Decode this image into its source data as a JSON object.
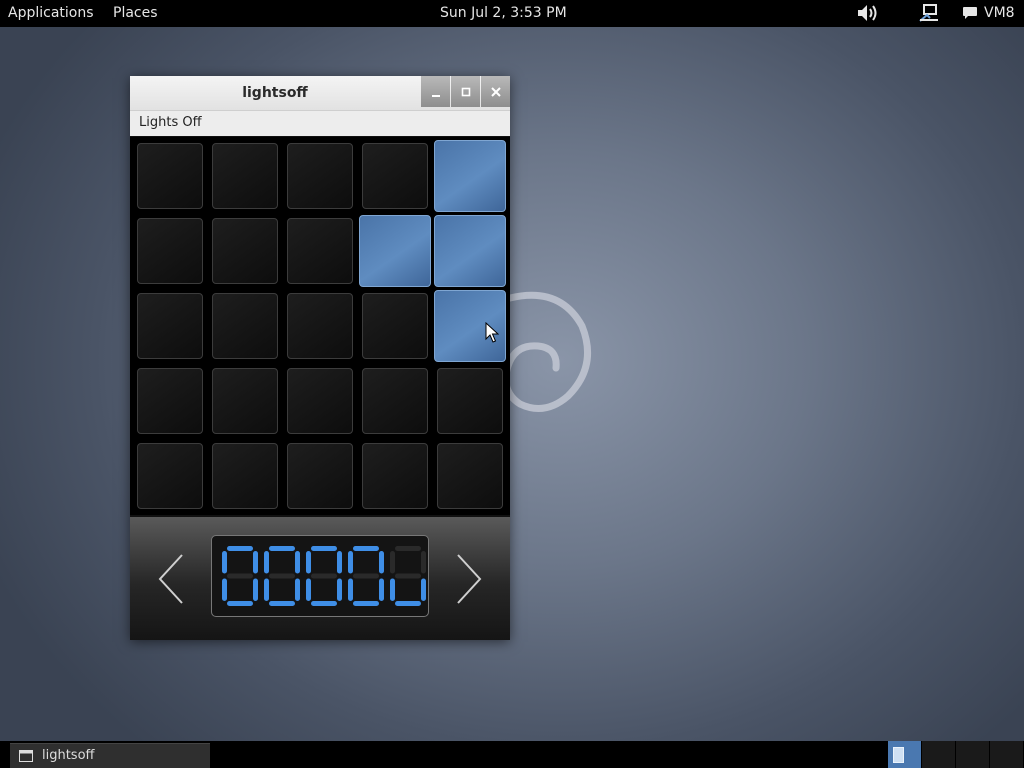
{
  "top_panel": {
    "applications": "Applications",
    "places": "Places",
    "clock": "Sun Jul  2,  3:53 PM",
    "user": "VM8"
  },
  "window": {
    "title": "lightsoff",
    "menu": [
      "Lights Off"
    ],
    "board": {
      "rows": 5,
      "cols": 5,
      "lights": [
        [
          0,
          0,
          0,
          0,
          1
        ],
        [
          0,
          0,
          0,
          1,
          1
        ],
        [
          0,
          0,
          0,
          0,
          1
        ],
        [
          0,
          0,
          0,
          0,
          0
        ],
        [
          0,
          0,
          0,
          0,
          0
        ]
      ]
    },
    "level_display": "0000",
    "level_suffix_glyph": "u"
  },
  "taskbar": {
    "tasks": [
      "lightsoff"
    ],
    "workspaces": 4,
    "active_workspace": 1
  },
  "colors": {
    "light_on": "#5a86bb",
    "lcd_segment": "#3f8ee6",
    "lcd_segment_off": "#2a2a2a"
  }
}
